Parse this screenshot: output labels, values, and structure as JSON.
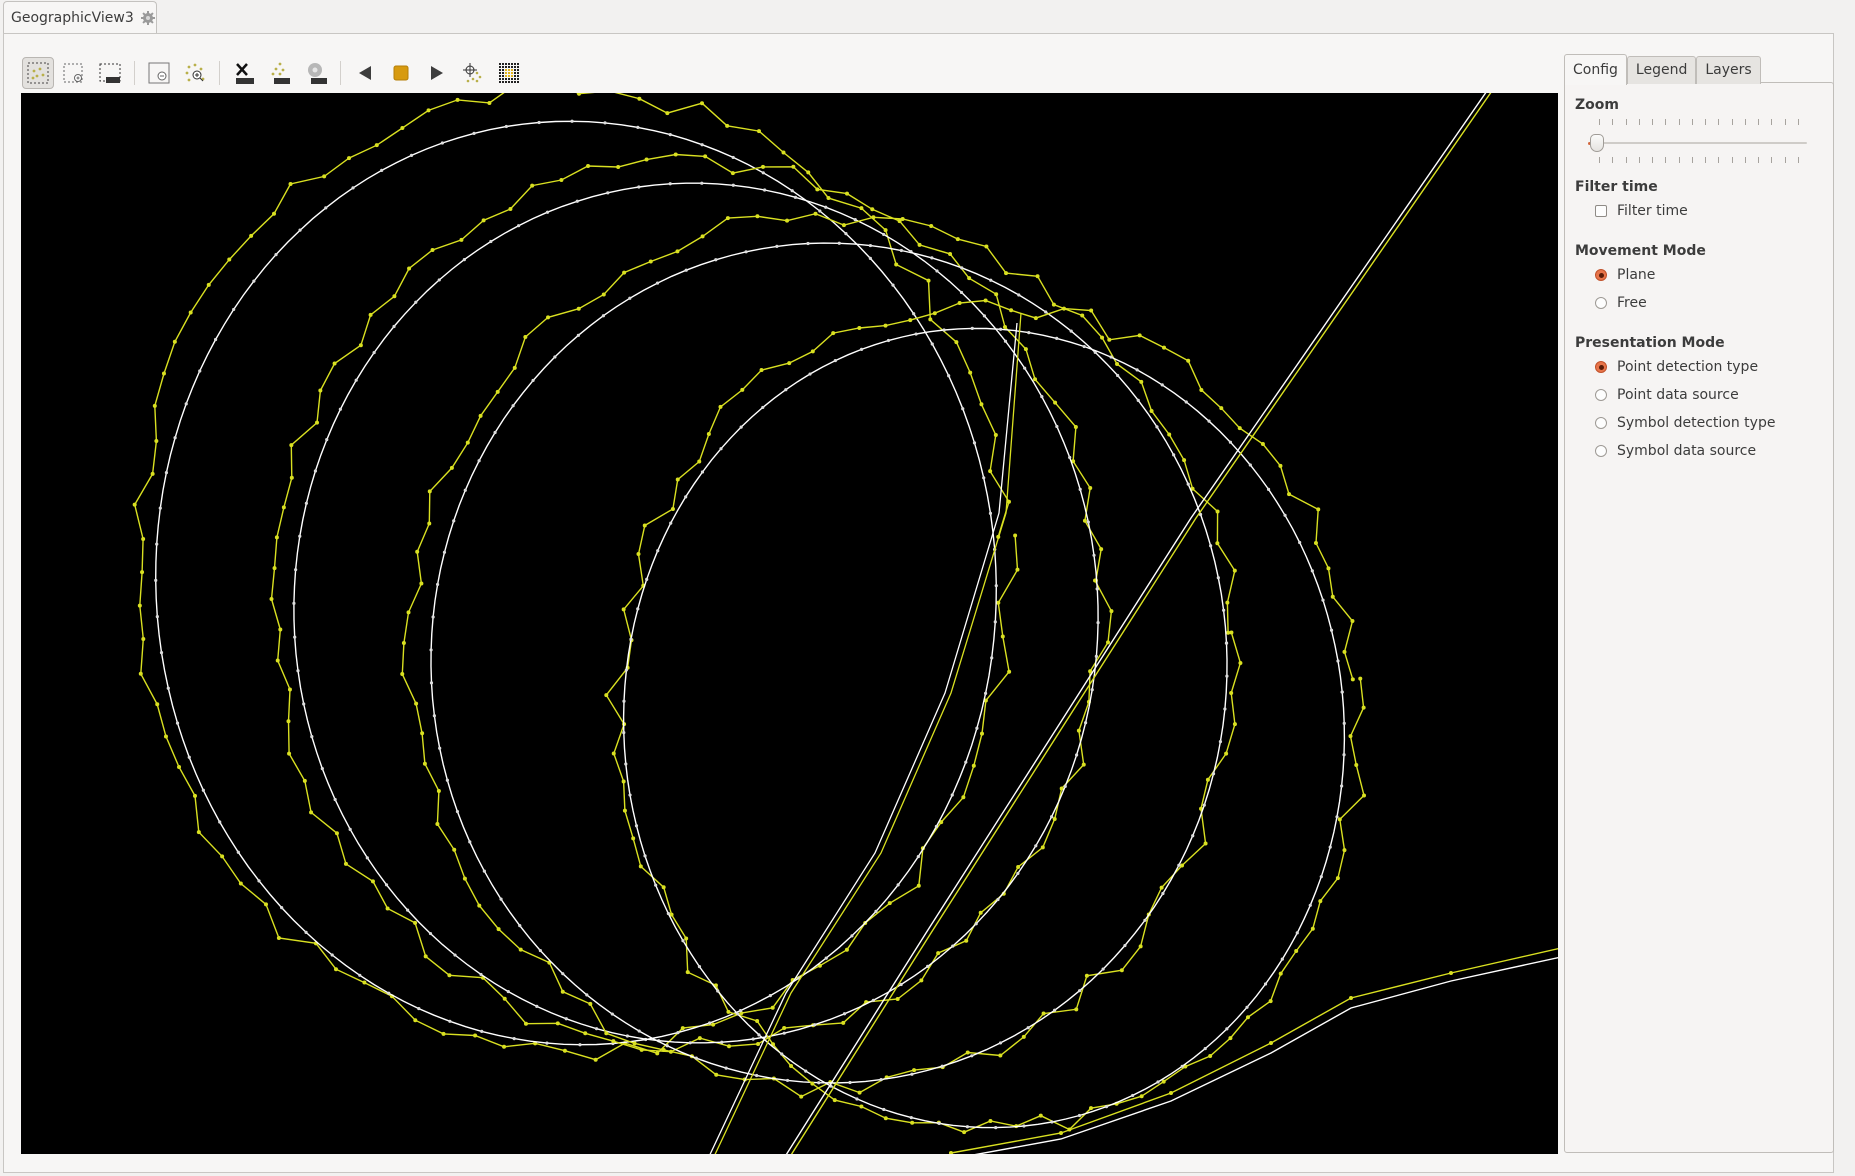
{
  "window": {
    "tab_title": "GeographicView3",
    "tab_icon": "gear-icon"
  },
  "toolbar": {
    "groups": [
      [
        {
          "name": "select-rectangle",
          "icon": "selection-points-icon",
          "active": true
        },
        {
          "name": "zoom-rectangle",
          "icon": "selection-zoom-icon",
          "active": false
        },
        {
          "name": "label-rectangle",
          "icon": "selection-label-icon",
          "active": false
        }
      ],
      [
        {
          "name": "zoom-out",
          "icon": "zoom-out-rect-icon",
          "active": false
        },
        {
          "name": "zoom-points",
          "icon": "zoom-points-icon",
          "active": false
        }
      ],
      [
        {
          "name": "clear-labels",
          "icon": "clear-label-icon",
          "active": false
        },
        {
          "name": "points-label",
          "icon": "points-label-icon",
          "active": false
        },
        {
          "name": "settings-label",
          "icon": "gear-label-icon",
          "active": false
        }
      ],
      [
        {
          "name": "step-back",
          "icon": "play-back-icon",
          "active": false
        },
        {
          "name": "stop",
          "icon": "stop-icon",
          "active": false
        },
        {
          "name": "play",
          "icon": "play-icon",
          "active": false
        },
        {
          "name": "center-points",
          "icon": "crosshair-points-icon",
          "active": false
        },
        {
          "name": "grid",
          "icon": "grid-icon",
          "active": false
        }
      ]
    ]
  },
  "map": {
    "background": "#000000",
    "track_color": "#d9e021",
    "reference_color": "#ffffff"
  },
  "side_panel": {
    "tabs": [
      {
        "label": "Config",
        "active": true
      },
      {
        "label": "Legend",
        "active": false
      },
      {
        "label": "Layers",
        "active": false
      }
    ],
    "zoom": {
      "title": "Zoom",
      "value_fraction": 0.0,
      "tick_count": 16
    },
    "filter_time": {
      "title": "Filter time",
      "checkbox_label": "Filter time",
      "checked": false
    },
    "movement_mode": {
      "title": "Movement Mode",
      "options": [
        {
          "label": "Plane",
          "selected": true
        },
        {
          "label": "Free",
          "selected": false
        }
      ]
    },
    "presentation_mode": {
      "title": "Presentation Mode",
      "options": [
        {
          "label": "Point detection type",
          "selected": true
        },
        {
          "label": "Point data source",
          "selected": false
        },
        {
          "label": "Symbol detection type",
          "selected": false
        },
        {
          "label": "Symbol data source",
          "selected": false
        }
      ]
    }
  }
}
